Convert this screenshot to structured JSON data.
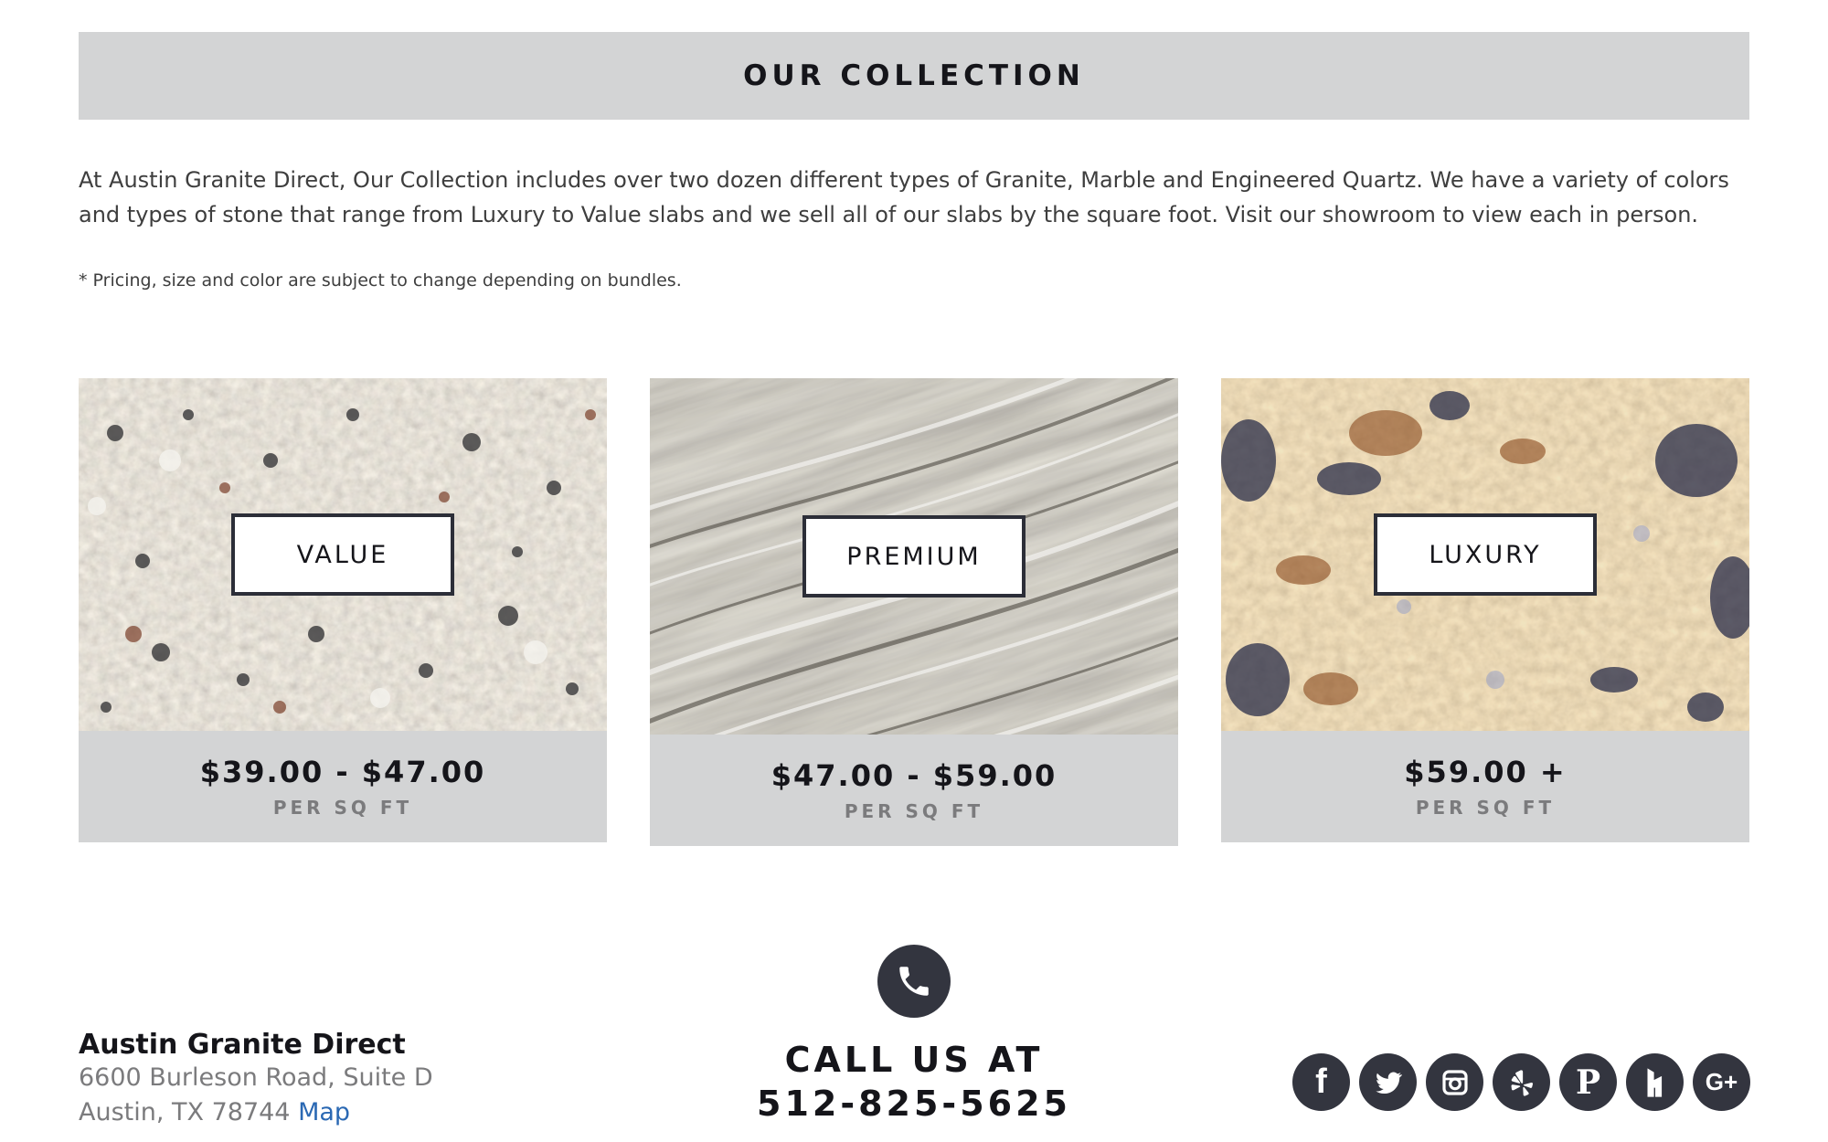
{
  "collection": {
    "title": "OUR COLLECTION",
    "intro": "At Austin Granite Direct, Our Collection includes over two dozen different types of Granite, Marble and Engineered Quartz. We have a variety of colors and types of stone that range from Luxury to Value slabs and we sell all of our slabs by the square foot. Visit our showroom to view each in person.",
    "note": "* Pricing, size and color are subject to change depending on bundles."
  },
  "tiers": [
    {
      "label": "VALUE",
      "price": "$39.00 - $47.00",
      "unit": "PER SQ FT"
    },
    {
      "label": "PREMIUM",
      "price": "$47.00 - $59.00",
      "unit": "PER SQ FT"
    },
    {
      "label": "LUXURY",
      "price": "$59.00 +",
      "unit": "PER SQ FT"
    }
  ],
  "footer": {
    "business_name": "Austin Granite Direct",
    "address_line1": "6600 Burleson Road, Suite D",
    "address_line2": "Austin, TX 78744",
    "map_link": "Map",
    "call_label": "CALL US AT",
    "phone": "512-825-5625"
  },
  "social_icons": [
    "facebook-icon",
    "twitter-icon",
    "instagram-icon",
    "yelp-icon",
    "pinterest-icon",
    "houzz-icon",
    "google-plus-icon"
  ],
  "colors": {
    "banner_bg": "#d3d4d5",
    "dark_icon": "#33353f",
    "link": "#2a68b3",
    "muted_text": "#7b7b7d"
  }
}
